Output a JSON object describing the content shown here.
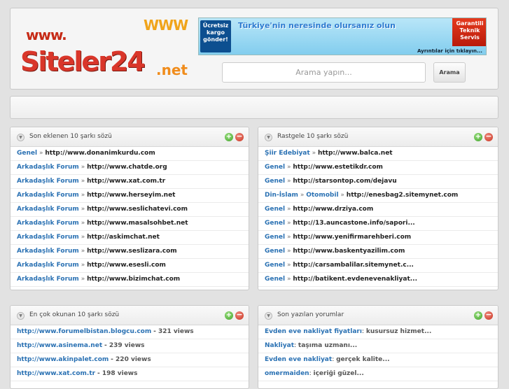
{
  "header": {
    "logo": {
      "prefix": "www.",
      "deco": "WWW",
      "name": "Siteler24",
      "tld": ".net"
    },
    "banner": {
      "left": "Ücretsiz kargo gönder!",
      "headline": "Türkiye'nin neresinde olursanız olun",
      "right": "Garantili Teknik Servis",
      "footer": "Ayrıntılar için tıklayın..."
    },
    "search": {
      "placeholder": "Arama yapın...",
      "button_label": "Arama"
    }
  },
  "panels": {
    "latest": {
      "title": "Son eklenen 10 şarkı sözü",
      "items": [
        {
          "category": "Genel",
          "url": "http://www.donanimkurdu.com"
        },
        {
          "category": "Arkadaşlık Forum",
          "url": "http://www.chatde.org"
        },
        {
          "category": "Arkadaşlık Forum",
          "url": "http://www.xat.com.tr"
        },
        {
          "category": "Arkadaşlık Forum",
          "url": "http://www.herseyim.net"
        },
        {
          "category": "Arkadaşlık Forum",
          "url": "http://www.seslichatevi.com"
        },
        {
          "category": "Arkadaşlık Forum",
          "url": "http://www.masalsohbet.net"
        },
        {
          "category": "Arkadaşlık Forum",
          "url": "http://askimchat.net"
        },
        {
          "category": "Arkadaşlık Forum",
          "url": "http://www.seslizara.com"
        },
        {
          "category": "Arkadaşlık Forum",
          "url": "http://www.esesli.com"
        },
        {
          "category": "Arkadaşlık Forum",
          "url": "http://www.bizimchat.com"
        }
      ]
    },
    "random": {
      "title": "Rastgele 10 şarkı sözü",
      "items": [
        {
          "category": "Şiir Edebiyat",
          "url": "http://www.balca.net"
        },
        {
          "category": "Genel",
          "url": "http://www.estetikdr.com"
        },
        {
          "category": "Genel",
          "url": "http://starsontop.com/dejavu"
        },
        {
          "category": "Din-İslam",
          "subcategory": "Otomobil",
          "url": "http://enesbag2.sitemynet.com"
        },
        {
          "category": "Genel",
          "url": "http://www.drziya.com"
        },
        {
          "category": "Genel",
          "url": "http://13.auncastone.info/sapori..."
        },
        {
          "category": "Genel",
          "url": "http://www.yenifirmarehberi.com"
        },
        {
          "category": "Genel",
          "url": "http://www.baskentyazilim.com"
        },
        {
          "category": "Genel",
          "url": "http://carsambalilar.sitemynet.c..."
        },
        {
          "category": "Genel",
          "url": "http://batikent.evdenevenakliyat..."
        }
      ]
    },
    "most_read": {
      "title": "En çok okunan 10 şarkı sözü",
      "items": [
        {
          "url": "http://www.forumelbistan.blogcu.com",
          "views": "- 321 views"
        },
        {
          "url": "http://www.asinema.net",
          "views": "- 239 views"
        },
        {
          "url": "http://www.akinpalet.com",
          "views": "- 220 views"
        },
        {
          "url": "http://www.xat.com.tr",
          "views": "- 198 views"
        }
      ]
    },
    "comments": {
      "title": "Son yazılan yorumlar",
      "items": [
        {
          "topic": "Evden eve nakliyat fiyatları",
          "text": "kusursuz hizmet..."
        },
        {
          "topic": "Nakliyat",
          "text": "taşıma uzmanı..."
        },
        {
          "topic": "Evden eve nakliyat",
          "text": "gerçek kalite..."
        },
        {
          "topic": "omermaiden",
          "text": "içeriği güzel..."
        }
      ]
    }
  },
  "separator": "»",
  "colors": {
    "link": "#2a71b3",
    "add": "#3fa12a",
    "remove": "#c7321f",
    "logo_red": "#d9362a"
  }
}
